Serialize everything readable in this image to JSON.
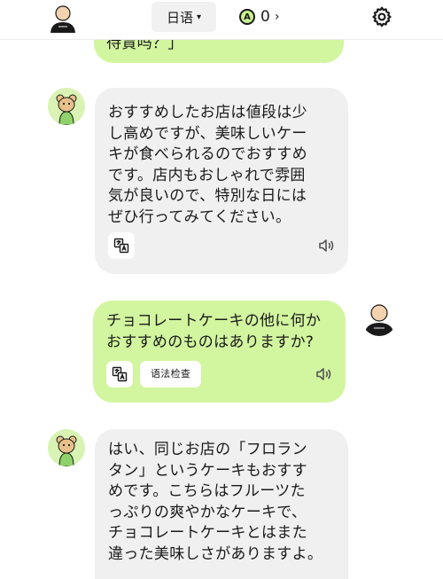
{
  "header": {
    "language": "日语",
    "points": "0"
  },
  "messages": [
    {
      "role": "user",
      "text": "待貰吗？」"
    },
    {
      "role": "ai",
      "text": "おすすめしたお店は値段は少\nし高めですが、美味しいケー\nキが食べられるのでおすすめ\nです。店内もおしゃれで雰囲\n気が良いので、特別な日には\nぜひ行ってみてください。"
    },
    {
      "role": "user",
      "text": "チョコレートケーキの他に何か\nおすすめのものはありますか?",
      "grammar_label": "语法检查"
    },
    {
      "role": "ai",
      "text": "はい、同じお店の「フロラン\nタン」というケーキもおすす\nめです。こちらはフルーツた\nっぷりの爽やかなケーキで、\nチョコレートケーキとはまた\n違った美味しさがありますよ。"
    }
  ],
  "colors": {
    "user_bubble": "#d2f59f",
    "ai_bubble": "#f0f0f0",
    "accent": "#c8f08f"
  }
}
